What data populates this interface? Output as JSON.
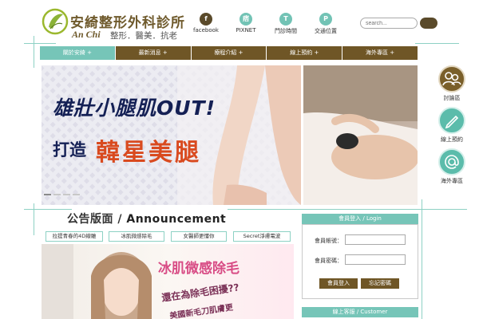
{
  "header": {
    "logo_title": "安綺整形外科診所",
    "logo_en": "An Chi",
    "logo_sub": "整形．醫美．抗老",
    "links": [
      {
        "icon": "facebook-icon",
        "glyph": "f",
        "label": "facebook"
      },
      {
        "icon": "pixnet-icon",
        "glyph": "痞",
        "label": "PIXNET"
      },
      {
        "icon": "clinic-hours-icon",
        "glyph": "T",
        "label": "門診時間"
      },
      {
        "icon": "location-icon",
        "glyph": "P",
        "label": "交通位置"
      }
    ],
    "search_placeholder": "search..."
  },
  "nav": {
    "items": [
      {
        "label": "關於安綺 +",
        "active": true
      },
      {
        "label": "最新消息 +",
        "active": false
      },
      {
        "label": "療程介紹 +",
        "active": false
      },
      {
        "label": "線上預約 +",
        "active": false
      },
      {
        "label": "海外專區 +",
        "active": false
      }
    ]
  },
  "banner": {
    "headline": "雄壯小腿肌OUT!",
    "line2_prefix": "打造",
    "line2_highlight": "韓星美腿",
    "slide_count": 4,
    "active_slide": 1
  },
  "side_buttons": [
    {
      "icon": "discussion-icon",
      "label": "討論區"
    },
    {
      "icon": "pen-icon",
      "label": "線上預約"
    },
    {
      "icon": "at-icon",
      "label": "海外專區"
    }
  ],
  "announcement": {
    "title_zh": "公告版面",
    "title_sep": " / ",
    "title_en": "Announcement",
    "tags": [
      "拉提青春的4D線雕",
      "冰肌微感除毛",
      "女醫師更懂你",
      "Secret淨膚電波"
    ],
    "promo_line1": "冰肌微感除毛",
    "promo_line2": "還在為除毛困擾??",
    "promo_line3": "美國新毛刀肌膚更"
  },
  "login": {
    "header": "會員登入 / Login",
    "account_label": "會員帳號：",
    "password_label": "會員密碼：",
    "login_button": "會員登入",
    "forgot_button": "忘記密碼"
  },
  "service": {
    "header": "線上客服 / Customer"
  },
  "colors": {
    "brand_brown": "#6f5626",
    "accent_teal": "#76c5b8",
    "banner_navy": "#142055",
    "banner_orange": "#d94a1f"
  }
}
